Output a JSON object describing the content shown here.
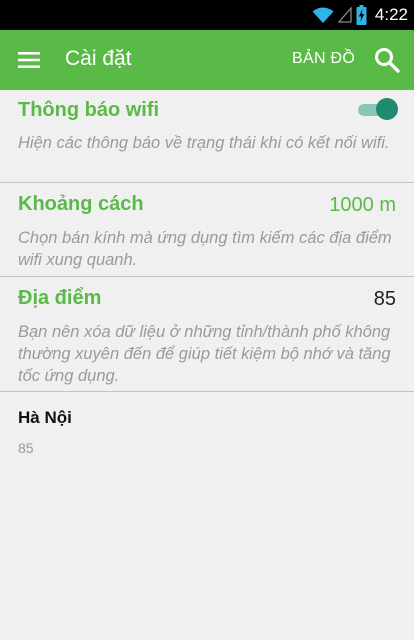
{
  "status_bar": {
    "time": "4:22",
    "icons": [
      "wifi-icon",
      "signal-icon",
      "battery-charging-icon"
    ]
  },
  "app_bar": {
    "title": "Cài đặt",
    "map_label": "BẢN ĐỒ",
    "icons": [
      "hamburger-menu-icon",
      "search-icon"
    ],
    "color": "#5aba47"
  },
  "settings": {
    "wifi_notifications": {
      "title": "Thông báo wifi",
      "summary": "Hiện các thông báo về trạng thái khi có kết nối wifi.",
      "enabled": true
    },
    "distance": {
      "title": "Khoảng cách",
      "value": "1000 m",
      "summary": "Chọn bán kính mà ứng dụng tìm kiếm các địa điểm wifi xung quanh."
    },
    "locations": {
      "title": "Địa điểm",
      "value": "85",
      "summary": "Bạn nên xóa dữ liệu ở những tỉnh/thành phố không thường xuyên đến để giúp tiết kiệm bộ nhớ và tăng tốc ứng dụng."
    }
  },
  "cities": [
    {
      "name": "Hà Nội",
      "count": "85"
    }
  ]
}
